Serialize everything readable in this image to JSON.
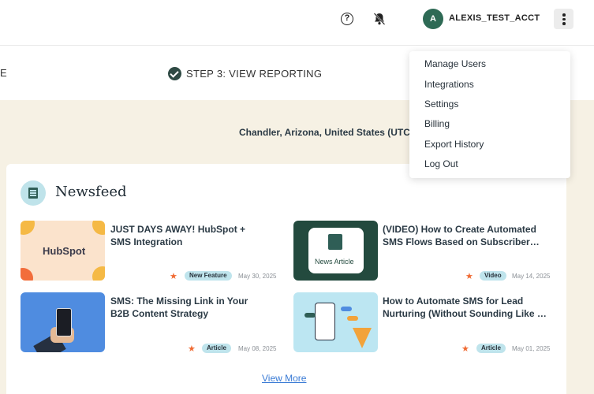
{
  "header": {
    "account_initial": "A",
    "account_name": "ALEXIS_TEST_ACCT",
    "help_glyph": "?",
    "icons": [
      "help-circle-icon",
      "bell-off-icon",
      "more-vertical-icon"
    ]
  },
  "steps": {
    "previous_fragment": "E",
    "step3_label": "STEP 3: VIEW REPORTING"
  },
  "location": "Chandler, Arizona, United States (UTC",
  "newsfeed": {
    "title": "Newsfeed",
    "articles": [
      {
        "title": "JUST DAYS AWAY! HubSpot + SMS Integration",
        "tag": "New Feature",
        "date": "May 30, 2025",
        "thumb_text": "HubSpot"
      },
      {
        "title": "(VIDEO) How to Create Automated SMS Flows Based on Subscriber…",
        "tag": "Video",
        "date": "May 14, 2025",
        "thumb_text": "News Article"
      },
      {
        "title": "SMS: The Missing Link in Your B2B Content Strategy",
        "tag": "Article",
        "date": "May 08, 2025"
      },
      {
        "title": "How to Automate SMS for Lead Nurturing (Without Sounding Like …",
        "tag": "Article",
        "date": "May 01, 2025"
      }
    ],
    "view_more": "View More"
  },
  "menu": {
    "items": [
      "Manage Users",
      "Integrations",
      "Settings",
      "Billing",
      "Export History",
      "Log Out"
    ]
  },
  "colors": {
    "accent_green": "#2e6a55",
    "badge_bg": "#bfe4ec",
    "page_bg": "#f6f1e4",
    "star": "#f06a32",
    "link": "#3a7bd5"
  }
}
